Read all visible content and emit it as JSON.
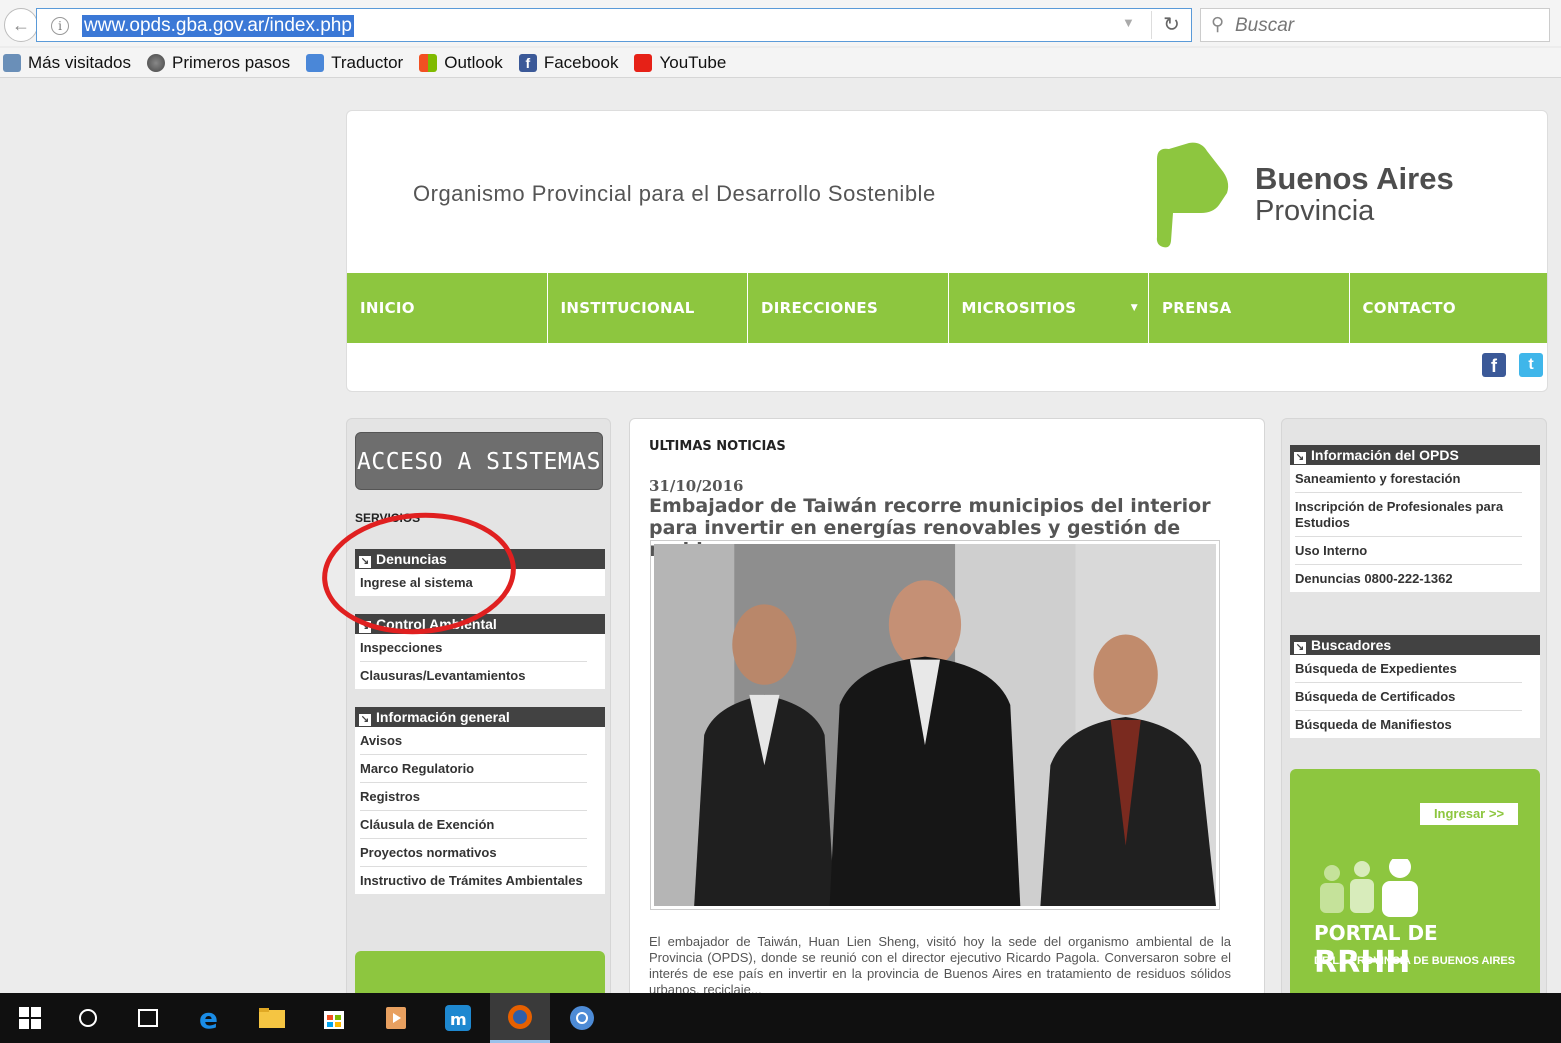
{
  "browser": {
    "url": "www.opds.gba.gov.ar/index.php",
    "search_placeholder": "Buscar",
    "bookmarks": [
      "Más visitados",
      "Primeros pasos",
      "Traductor",
      "Outlook",
      "Facebook",
      "YouTube"
    ]
  },
  "header": {
    "org_name": "Organismo Provincial para el Desarrollo Sostenible",
    "logo_line1": "Buenos Aires",
    "logo_line2": "Provincia",
    "logo_color": "#8dc63f"
  },
  "nav": [
    "INICIO",
    "INSTITUCIONAL",
    "DIRECCIONES",
    "MICROSITIOS",
    "PRENSA",
    "CONTACTO"
  ],
  "left": {
    "acceso_label": "ACCESO A SISTEMAS",
    "servicios_label": "SERVICIOS",
    "denuncias": {
      "title": "Denuncias",
      "items": [
        "Ingrese al sistema"
      ]
    },
    "control": {
      "title": "Control Ambiental",
      "items": [
        "Inspecciones",
        "Clausuras/Levantamientos"
      ]
    },
    "info": {
      "title": "Información general",
      "items": [
        "Avisos",
        "Marco Regulatorio",
        "Registros",
        "Cláusula de Exención",
        "Proyectos normativos",
        "Instructivo de Trámites Ambientales"
      ]
    }
  },
  "main": {
    "heading": "ULTIMAS NOTICIAS",
    "date": "31/10/2016",
    "title": "Embajador de Taiwán recorre municipios del interior para invertir en energías renovables y gestión de residuos",
    "body": "El embajador de Taiwán, Huan Lien Sheng, visitó hoy la sede del organismo ambiental de la Provincia (OPDS), donde se reunió con el director ejecutivo Ricardo Pagola. Conversaron sobre el interés de ese país en invertir en la provincia de Buenos Aires en tratamiento de residuos sólidos urbanos, reciclaje..."
  },
  "right": {
    "info_opds": {
      "title": "Información del OPDS",
      "items": [
        "Saneamiento y forestación",
        "Inscripción de Profesionales para Estudios",
        "Uso Interno",
        "Denuncias 0800-222-1362"
      ]
    },
    "buscadores": {
      "title": "Buscadores",
      "items": [
        "Búsqueda de Expedientes",
        "Búsqueda de Certificados",
        "Búsqueda de Manifiestos"
      ]
    },
    "portal": {
      "ingresar": "Ingresar >>",
      "title_small": "PORTAL DE",
      "title_big": "RRHH",
      "subtitle": "DE LA PROVINCIA DE BUENOS AIRES"
    }
  },
  "taskbar": {
    "icons": [
      "windows-start-icon",
      "cortana-icon",
      "task-view-icon",
      "edge-icon",
      "file-explorer-icon",
      "store-icon",
      "media-player-icon",
      "maxthon-icon",
      "firefox-icon",
      "chrome-icon"
    ]
  }
}
